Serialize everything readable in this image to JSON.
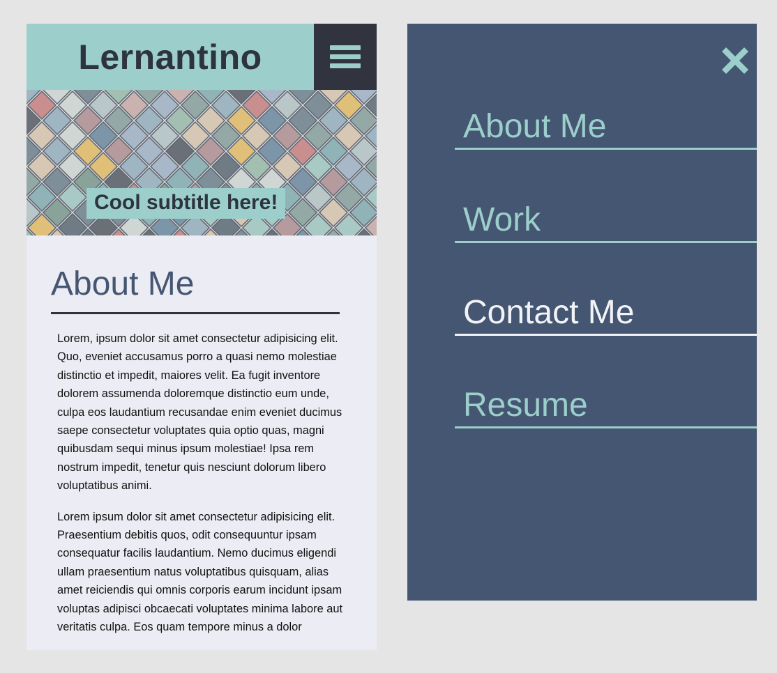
{
  "site": {
    "brand": "Lernantino",
    "menu_icon": "hamburger-menu-icon",
    "subtitle": "Cool subtitle here!"
  },
  "about": {
    "title": "About Me",
    "paragraphs": [
      "Lorem, ipsum dolor sit amet consectetur adipisicing elit. Quo, eveniet accusamus porro a quasi nemo molestiae distinctio et impedit, maiores velit. Ea fugit inventore dolorem assumenda doloremque distinctio eum unde, culpa eos laudantium recusandae enim eveniet ducimus saepe consectetur voluptates quia optio quas, magni quibusdam sequi minus ipsum molestiae! Ipsa rem nostrum impedit, tenetur quis nesciunt dolorum libero voluptatibus animi.",
      "Lorem ipsum dolor sit amet consectetur adipisicing elit. Praesentium debitis quos, odit consequuntur ipsam consequatur facilis laudantium. Nemo ducimus eligendi ullam praesentium natus voluptatibus quisquam, alias amet reiciendis qui omnis corporis earum incidunt ipsam voluptas adipisci obcaecati voluptates minima labore aut veritatis culpa. Eos quam tempore minus a dolor"
    ]
  },
  "nav": {
    "close_icon": "close-x-icon",
    "items": [
      {
        "label": "About Me",
        "active": false
      },
      {
        "label": "Work",
        "active": false
      },
      {
        "label": "Contact Me",
        "active": true
      },
      {
        "label": "Resume",
        "active": false
      }
    ]
  },
  "colors": {
    "teal": "#9ccfcb",
    "navy": "#455672",
    "charcoal": "#31333f",
    "page_bg": "#ececf4",
    "canvas_bg": "#e5e5e5"
  }
}
